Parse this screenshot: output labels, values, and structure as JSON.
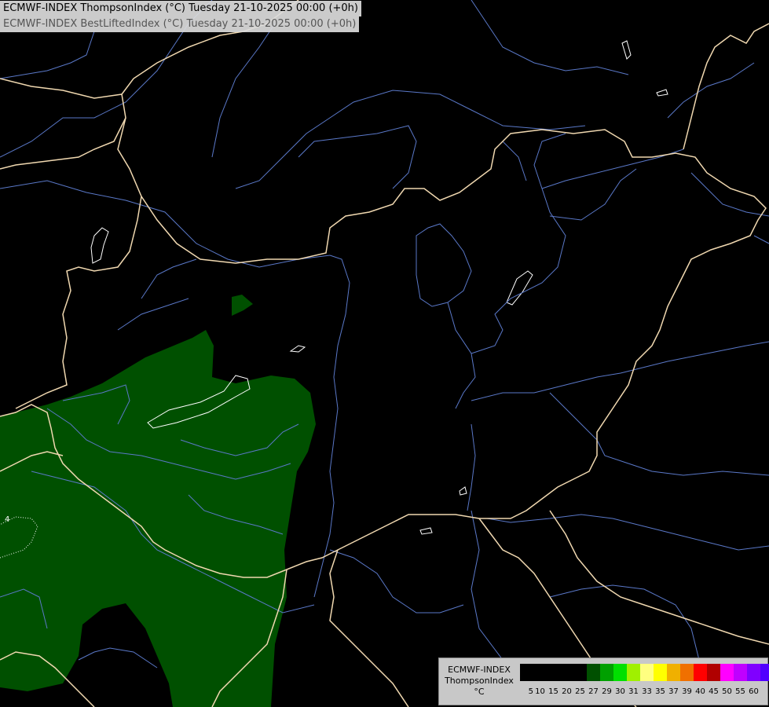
{
  "header": {
    "title_line_1": "ECMWF-INDEX ThompsonIndex (°C) Tuesday 21-10-2025 00:00 (+0h)",
    "title_line_2": "ECMWF-INDEX BestLiftedIndex (°C) Tuesday 21-10-2025 00:00 (+0h)"
  },
  "map": {
    "background_color": "#000000",
    "field_color": "#005000",
    "border_color": "#f0d8b0",
    "river_color": "#5a78c8",
    "lake_outline_color": "#ffffff",
    "contour_label": "4"
  },
  "legend": {
    "model": "ECMWF-INDEX",
    "parameter": "ThompsonIndex",
    "unit": "°C",
    "colors": [
      "#000000",
      "#000000",
      "#000000",
      "#000000",
      "#000000",
      "#005000",
      "#00a000",
      "#00e000",
      "#a0f000",
      "#ffff80",
      "#ffff00",
      "#f0b000",
      "#f07000",
      "#ff0000",
      "#b00000",
      "#ff00ff",
      "#c000ff",
      "#8000ff",
      "#5000ff",
      "#0000ff"
    ],
    "ticks": [
      "5",
      "10",
      "15",
      "20",
      "25",
      "27",
      "29",
      "30",
      "31",
      "33",
      "35",
      "37",
      "39",
      "40",
      "45",
      "50",
      "55",
      "60"
    ]
  }
}
